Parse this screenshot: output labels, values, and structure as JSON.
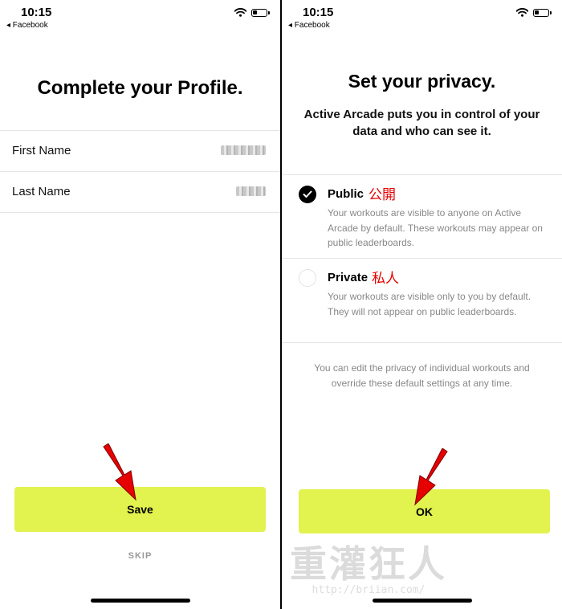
{
  "left_screen": {
    "status": {
      "time": "10:15",
      "back_app": "◂ Facebook"
    },
    "title": "Complete your Profile.",
    "fields": [
      {
        "label": "First Name"
      },
      {
        "label": "Last Name"
      }
    ],
    "save_label": "Save",
    "skip_label": "SKIP"
  },
  "right_screen": {
    "status": {
      "time": "10:15",
      "back_app": "◂ Facebook"
    },
    "title": "Set your privacy.",
    "subtitle": "Active Arcade puts you in control of your data and who can see it.",
    "options": [
      {
        "title": "Public",
        "note": "公開",
        "checked": true,
        "description": "Your workouts are visible to anyone on Active Arcade by default. These workouts may appear on public leaderboards."
      },
      {
        "title": "Private",
        "note": "私人",
        "checked": false,
        "description": "Your workouts are visible only to you by default. They will not appear on public leaderboards."
      }
    ],
    "footnote": "You can edit the privacy of individual workouts and override these default settings at any time.",
    "ok_label": "OK"
  },
  "watermark": {
    "text": "重灌狂人",
    "url": "http://briian.com/"
  },
  "colors": {
    "accent": "#e2f24e",
    "annotation_arrow": "#e60000",
    "muted_text": "#888888"
  },
  "icons": {
    "wifi": "wifi-icon",
    "battery": "battery-icon",
    "check": "checkmark-icon",
    "arrow": "red-arrow-icon"
  }
}
